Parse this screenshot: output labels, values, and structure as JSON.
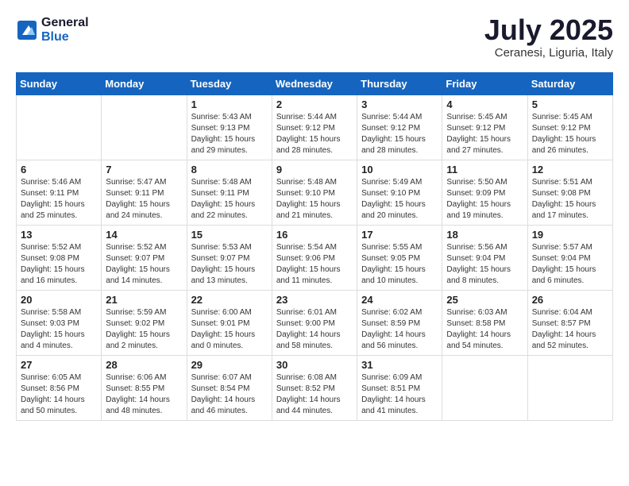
{
  "logo": {
    "line1": "General",
    "line2": "Blue"
  },
  "title": "July 2025",
  "subtitle": "Ceranesi, Liguria, Italy",
  "weekdays": [
    "Sunday",
    "Monday",
    "Tuesday",
    "Wednesday",
    "Thursday",
    "Friday",
    "Saturday"
  ],
  "weeks": [
    [
      {
        "day": "",
        "info": ""
      },
      {
        "day": "",
        "info": ""
      },
      {
        "day": "1",
        "info": "Sunrise: 5:43 AM\nSunset: 9:13 PM\nDaylight: 15 hours\nand 29 minutes."
      },
      {
        "day": "2",
        "info": "Sunrise: 5:44 AM\nSunset: 9:12 PM\nDaylight: 15 hours\nand 28 minutes."
      },
      {
        "day": "3",
        "info": "Sunrise: 5:44 AM\nSunset: 9:12 PM\nDaylight: 15 hours\nand 28 minutes."
      },
      {
        "day": "4",
        "info": "Sunrise: 5:45 AM\nSunset: 9:12 PM\nDaylight: 15 hours\nand 27 minutes."
      },
      {
        "day": "5",
        "info": "Sunrise: 5:45 AM\nSunset: 9:12 PM\nDaylight: 15 hours\nand 26 minutes."
      }
    ],
    [
      {
        "day": "6",
        "info": "Sunrise: 5:46 AM\nSunset: 9:11 PM\nDaylight: 15 hours\nand 25 minutes."
      },
      {
        "day": "7",
        "info": "Sunrise: 5:47 AM\nSunset: 9:11 PM\nDaylight: 15 hours\nand 24 minutes."
      },
      {
        "day": "8",
        "info": "Sunrise: 5:48 AM\nSunset: 9:11 PM\nDaylight: 15 hours\nand 22 minutes."
      },
      {
        "day": "9",
        "info": "Sunrise: 5:48 AM\nSunset: 9:10 PM\nDaylight: 15 hours\nand 21 minutes."
      },
      {
        "day": "10",
        "info": "Sunrise: 5:49 AM\nSunset: 9:10 PM\nDaylight: 15 hours\nand 20 minutes."
      },
      {
        "day": "11",
        "info": "Sunrise: 5:50 AM\nSunset: 9:09 PM\nDaylight: 15 hours\nand 19 minutes."
      },
      {
        "day": "12",
        "info": "Sunrise: 5:51 AM\nSunset: 9:08 PM\nDaylight: 15 hours\nand 17 minutes."
      }
    ],
    [
      {
        "day": "13",
        "info": "Sunrise: 5:52 AM\nSunset: 9:08 PM\nDaylight: 15 hours\nand 16 minutes."
      },
      {
        "day": "14",
        "info": "Sunrise: 5:52 AM\nSunset: 9:07 PM\nDaylight: 15 hours\nand 14 minutes."
      },
      {
        "day": "15",
        "info": "Sunrise: 5:53 AM\nSunset: 9:07 PM\nDaylight: 15 hours\nand 13 minutes."
      },
      {
        "day": "16",
        "info": "Sunrise: 5:54 AM\nSunset: 9:06 PM\nDaylight: 15 hours\nand 11 minutes."
      },
      {
        "day": "17",
        "info": "Sunrise: 5:55 AM\nSunset: 9:05 PM\nDaylight: 15 hours\nand 10 minutes."
      },
      {
        "day": "18",
        "info": "Sunrise: 5:56 AM\nSunset: 9:04 PM\nDaylight: 15 hours\nand 8 minutes."
      },
      {
        "day": "19",
        "info": "Sunrise: 5:57 AM\nSunset: 9:04 PM\nDaylight: 15 hours\nand 6 minutes."
      }
    ],
    [
      {
        "day": "20",
        "info": "Sunrise: 5:58 AM\nSunset: 9:03 PM\nDaylight: 15 hours\nand 4 minutes."
      },
      {
        "day": "21",
        "info": "Sunrise: 5:59 AM\nSunset: 9:02 PM\nDaylight: 15 hours\nand 2 minutes."
      },
      {
        "day": "22",
        "info": "Sunrise: 6:00 AM\nSunset: 9:01 PM\nDaylight: 15 hours\nand 0 minutes."
      },
      {
        "day": "23",
        "info": "Sunrise: 6:01 AM\nSunset: 9:00 PM\nDaylight: 14 hours\nand 58 minutes."
      },
      {
        "day": "24",
        "info": "Sunrise: 6:02 AM\nSunset: 8:59 PM\nDaylight: 14 hours\nand 56 minutes."
      },
      {
        "day": "25",
        "info": "Sunrise: 6:03 AM\nSunset: 8:58 PM\nDaylight: 14 hours\nand 54 minutes."
      },
      {
        "day": "26",
        "info": "Sunrise: 6:04 AM\nSunset: 8:57 PM\nDaylight: 14 hours\nand 52 minutes."
      }
    ],
    [
      {
        "day": "27",
        "info": "Sunrise: 6:05 AM\nSunset: 8:56 PM\nDaylight: 14 hours\nand 50 minutes."
      },
      {
        "day": "28",
        "info": "Sunrise: 6:06 AM\nSunset: 8:55 PM\nDaylight: 14 hours\nand 48 minutes."
      },
      {
        "day": "29",
        "info": "Sunrise: 6:07 AM\nSunset: 8:54 PM\nDaylight: 14 hours\nand 46 minutes."
      },
      {
        "day": "30",
        "info": "Sunrise: 6:08 AM\nSunset: 8:52 PM\nDaylight: 14 hours\nand 44 minutes."
      },
      {
        "day": "31",
        "info": "Sunrise: 6:09 AM\nSunset: 8:51 PM\nDaylight: 14 hours\nand 41 minutes."
      },
      {
        "day": "",
        "info": ""
      },
      {
        "day": "",
        "info": ""
      }
    ]
  ]
}
